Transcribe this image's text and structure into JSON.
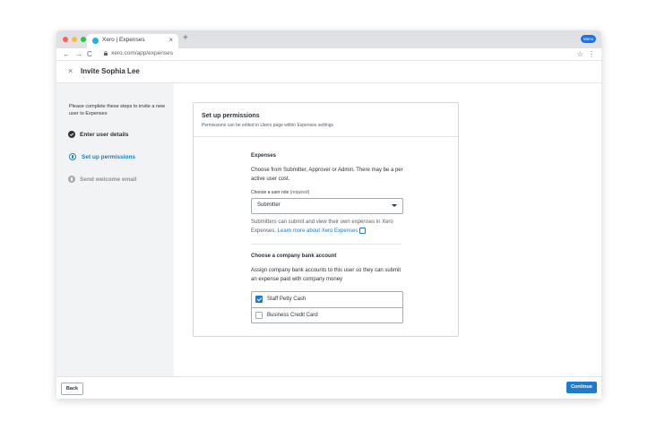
{
  "browser": {
    "tab_title": "Xero | Expenses",
    "tab_close": "×",
    "new_tab": "+",
    "url": "xero.com/app/expenses",
    "profile_label": "Menu",
    "traffic_lights": [
      "#ff5f57",
      "#febc2e",
      "#28c840"
    ]
  },
  "header": {
    "close_icon": "×",
    "title": "Invite Sophia Lee"
  },
  "sidebar": {
    "intro": "Please complete these steps to invite a new user to Expenses",
    "steps": [
      {
        "label": "Enter user details",
        "state": "complete"
      },
      {
        "label": "Set up permissions",
        "state": "current"
      },
      {
        "label": "Send welcome email",
        "state": "upcoming"
      }
    ]
  },
  "card": {
    "title": "Set up permissions",
    "subtitle": "Permissions can be edited in Users page within Expenses settings",
    "expenses": {
      "heading": "Expenses",
      "description": "Choose from Submitter, Approver or Admin. There may be a per active user cost.",
      "field_label": "Choose a user role",
      "field_required": "(required)",
      "selected_role": "Submitter",
      "help_text": "Submitters can submit and view their own expenses in Xero Expenses. ",
      "help_link": "Learn more about Xero Expenses"
    },
    "bank": {
      "heading": "Choose a company bank account",
      "description": "Assign company bank accounts to this user so they can submit an expense paid with company money",
      "accounts": [
        {
          "label": "Staff Petty Cash",
          "checked": true
        },
        {
          "label": "Business Credit Card",
          "checked": false
        }
      ]
    }
  },
  "footer": {
    "back_label": "Back",
    "continue_label": "Continue"
  },
  "colors": {
    "accent": "#1f7bcc",
    "current_step": "#1a7ec0",
    "complete_step": "#2d3339",
    "upcoming_step": "#8c9196"
  }
}
